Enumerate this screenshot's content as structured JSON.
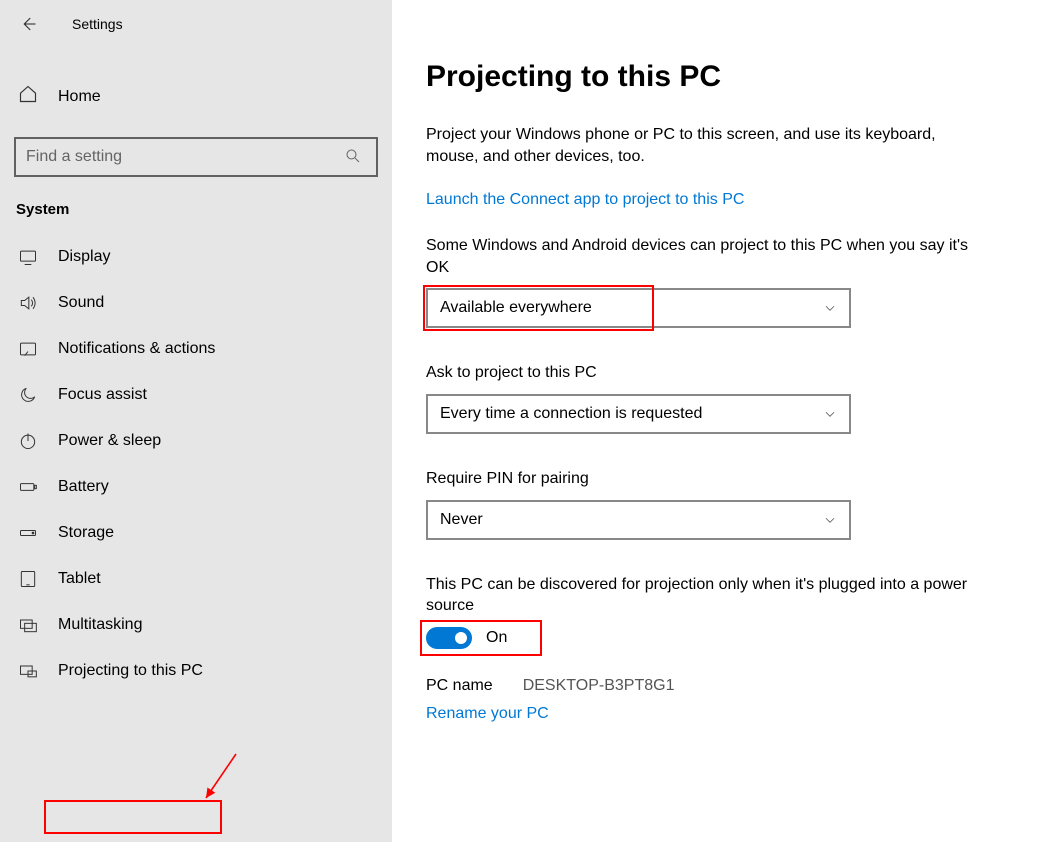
{
  "app": {
    "title": "Settings"
  },
  "sidebar": {
    "home": "Home",
    "search_placeholder": "Find a setting",
    "category": "System",
    "items": [
      {
        "label": "Display"
      },
      {
        "label": "Sound"
      },
      {
        "label": "Notifications & actions"
      },
      {
        "label": "Focus assist"
      },
      {
        "label": "Power & sleep"
      },
      {
        "label": "Battery"
      },
      {
        "label": "Storage"
      },
      {
        "label": "Tablet"
      },
      {
        "label": "Multitasking"
      },
      {
        "label": "Projecting to this PC"
      }
    ]
  },
  "main": {
    "title": "Projecting to this PC",
    "intro": "Project your Windows phone or PC to this screen, and use its keyboard, mouse, and other devices, too.",
    "launch_link": "Launch the Connect app to project to this PC",
    "field1_label": "Some Windows and Android devices can project to this PC when you say it's OK",
    "field1_value": "Available everywhere",
    "field2_label": "Ask to project to this PC",
    "field2_value": "Every time a connection is requested",
    "field3_label": "Require PIN for pairing",
    "field3_value": "Never",
    "field4_label": "This PC can be discovered for projection only when it's plugged into a power source",
    "toggle_state": "On",
    "pc_name_label": "PC name",
    "pc_name_value": "DESKTOP-B3PT8G1",
    "rename_link": "Rename your PC"
  }
}
